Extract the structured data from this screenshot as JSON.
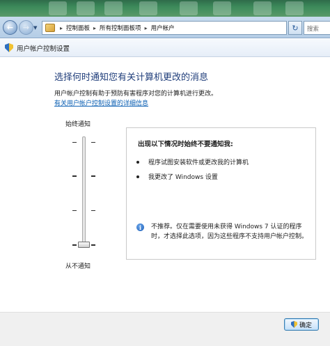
{
  "address_bar": {
    "crumbs": [
      "控制面板",
      "所有控制面板项",
      "用户帐户"
    ],
    "search_placeholder": "搜索"
  },
  "window": {
    "title": "用户帐户控制设置"
  },
  "main": {
    "heading": "选择何时通知您有关计算机更改的消息",
    "description": "用户帐户控制有助于预防有害程序对您的计算机进行更改。",
    "link": "有关用户帐户控制设置的详细信息"
  },
  "slider": {
    "top_label": "始终通知",
    "bottom_label": "从不通知",
    "levels": 4,
    "selected_level": 1
  },
  "panel": {
    "heading": "出现以下情况时始终不要通知我:",
    "bullets": [
      "程序试图安装软件或更改我的计算机",
      "我更改了 Windows 设置"
    ],
    "note": "不推荐。仅在需要使用未获得 Windows 7 认证的程序时，才选择此选项，因为这些程序不支持用户帐户控制。"
  },
  "footer": {
    "ok_label": "确定"
  },
  "colors": {
    "heading": "#1f3d7a",
    "link": "#0b5fb3",
    "address_bar": "#c9dcef"
  },
  "icons": {
    "back": "back-arrow-icon",
    "forward": "forward-arrow-icon",
    "refresh": "refresh-icon",
    "window": "uac-shield-icon",
    "info": "info-icon"
  }
}
